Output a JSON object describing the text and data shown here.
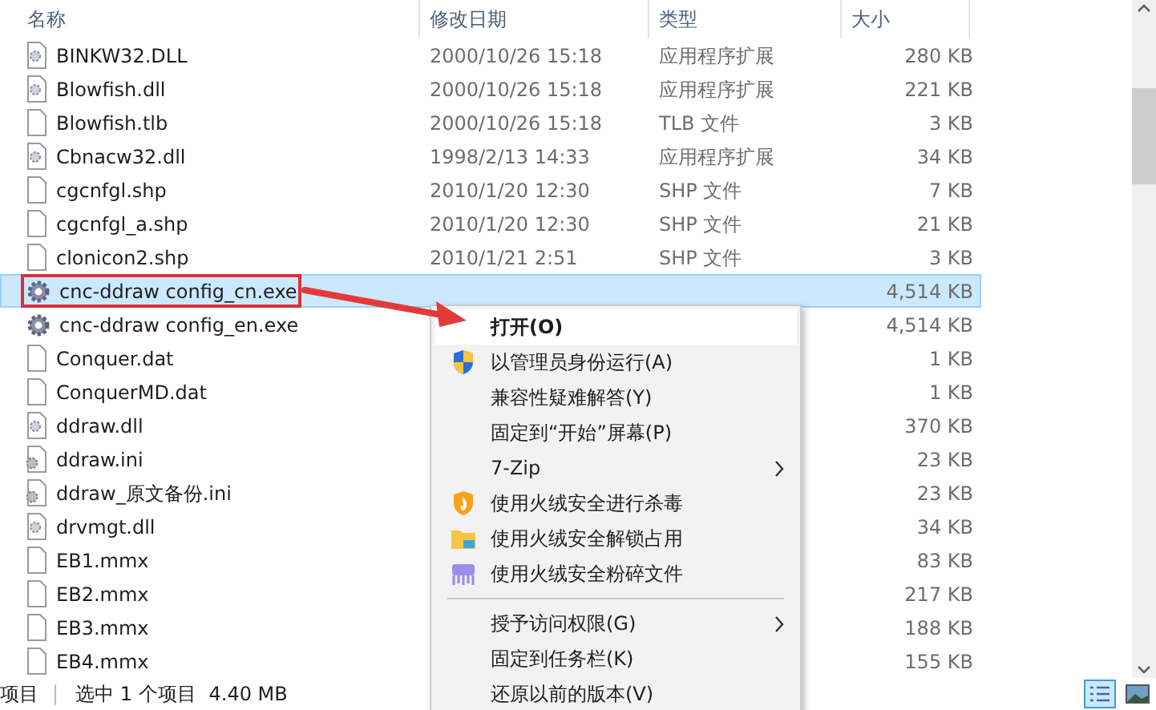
{
  "columns": [
    {
      "label": "名称"
    },
    {
      "label": "修改日期"
    },
    {
      "label": "类型"
    },
    {
      "label": "大小"
    }
  ],
  "files": [
    {
      "name": "BINKW32.DLL",
      "date": "2000/10/26 15:18",
      "type": "应用程序扩展",
      "size": "280 KB",
      "kind": "dll",
      "selected": false
    },
    {
      "name": "Blowfish.dll",
      "date": "2000/10/26 15:18",
      "type": "应用程序扩展",
      "size": "221 KB",
      "kind": "dll",
      "selected": false
    },
    {
      "name": "Blowfish.tlb",
      "date": "2000/10/26 15:18",
      "type": "TLB 文件",
      "size": "3 KB",
      "kind": "file",
      "selected": false
    },
    {
      "name": "Cbnacw32.dll",
      "date": "1998/2/13 14:33",
      "type": "应用程序扩展",
      "size": "34 KB",
      "kind": "dll",
      "selected": false
    },
    {
      "name": "cgcnfgl.shp",
      "date": "2010/1/20 12:30",
      "type": "SHP 文件",
      "size": "7 KB",
      "kind": "file",
      "selected": false
    },
    {
      "name": "cgcnfgl_a.shp",
      "date": "2010/1/20 12:30",
      "type": "SHP 文件",
      "size": "21 KB",
      "kind": "file",
      "selected": false
    },
    {
      "name": "clonicon2.shp",
      "date": "2010/1/21 2:51",
      "type": "SHP 文件",
      "size": "3 KB",
      "kind": "file",
      "selected": false
    },
    {
      "name": "cnc-ddraw config_cn.exe",
      "size": "4,514 KB",
      "kind": "exe",
      "selected": true,
      "annotated": true
    },
    {
      "name": "cnc-ddraw config_en.exe",
      "size": "4,514 KB",
      "kind": "exe",
      "selected": false
    },
    {
      "name": "Conquer.dat",
      "size": "1 KB",
      "kind": "file",
      "selected": false
    },
    {
      "name": "ConquerMD.dat",
      "size": "1 KB",
      "kind": "file",
      "selected": false
    },
    {
      "name": "ddraw.dll",
      "size": "370 KB",
      "kind": "dll",
      "selected": false
    },
    {
      "name": "ddraw.ini",
      "size": "23 KB",
      "kind": "ini",
      "selected": false
    },
    {
      "name": "ddraw_原文备份.ini",
      "size": "23 KB",
      "kind": "ini",
      "selected": false
    },
    {
      "name": "drvmgt.dll",
      "size": "34 KB",
      "kind": "dll",
      "selected": false
    },
    {
      "name": "EB1.mmx",
      "size": "83 KB",
      "kind": "file",
      "selected": false
    },
    {
      "name": "EB2.mmx",
      "size": "217 KB",
      "kind": "file",
      "selected": false
    },
    {
      "name": "EB3.mmx",
      "size": "188 KB",
      "kind": "file",
      "selected": false
    },
    {
      "name": "EB4.mmx",
      "size": "155 KB",
      "kind": "file",
      "selected": false
    }
  ],
  "context_menu": [
    {
      "kind": "plain",
      "label": "打开(O)",
      "bold": true,
      "selected": true,
      "submenu": false
    },
    {
      "kind": "shield",
      "label": "以管理员身份运行(A)",
      "bold": false,
      "selected": false,
      "submenu": false
    },
    {
      "kind": "plain",
      "label": "兼容性疑难解答(Y)",
      "bold": false,
      "selected": false,
      "submenu": false
    },
    {
      "kind": "plain",
      "label": "固定到“开始”屏幕(P)",
      "bold": false,
      "selected": false,
      "submenu": false
    },
    {
      "kind": "plain",
      "label": "7-Zip",
      "bold": false,
      "selected": false,
      "submenu": true
    },
    {
      "kind": "flame",
      "label": "使用火绒安全进行杀毒",
      "bold": false,
      "selected": false,
      "submenu": false
    },
    {
      "kind": "folder",
      "label": "使用火绒安全解锁占用",
      "bold": false,
      "selected": false,
      "submenu": false
    },
    {
      "kind": "shredder",
      "label": "使用火绒安全粉碎文件",
      "bold": false,
      "selected": false,
      "submenu": false
    },
    {
      "kind": "separator"
    },
    {
      "kind": "plain",
      "label": "授予访问权限(G)",
      "bold": false,
      "selected": false,
      "submenu": true
    },
    {
      "kind": "plain",
      "label": "固定到任务栏(K)",
      "bold": false,
      "selected": false,
      "submenu": false
    },
    {
      "kind": "plain",
      "label": "还原以前的版本(V)",
      "bold": false,
      "selected": false,
      "submenu": false
    }
  ],
  "status_bar": {
    "item_count": "项目",
    "selection": "选中 1 个项目",
    "selection_size": "4.40 MB"
  },
  "view_buttons": [
    {
      "kind": "details",
      "selected": true
    },
    {
      "kind": "preview",
      "selected": false
    }
  ]
}
